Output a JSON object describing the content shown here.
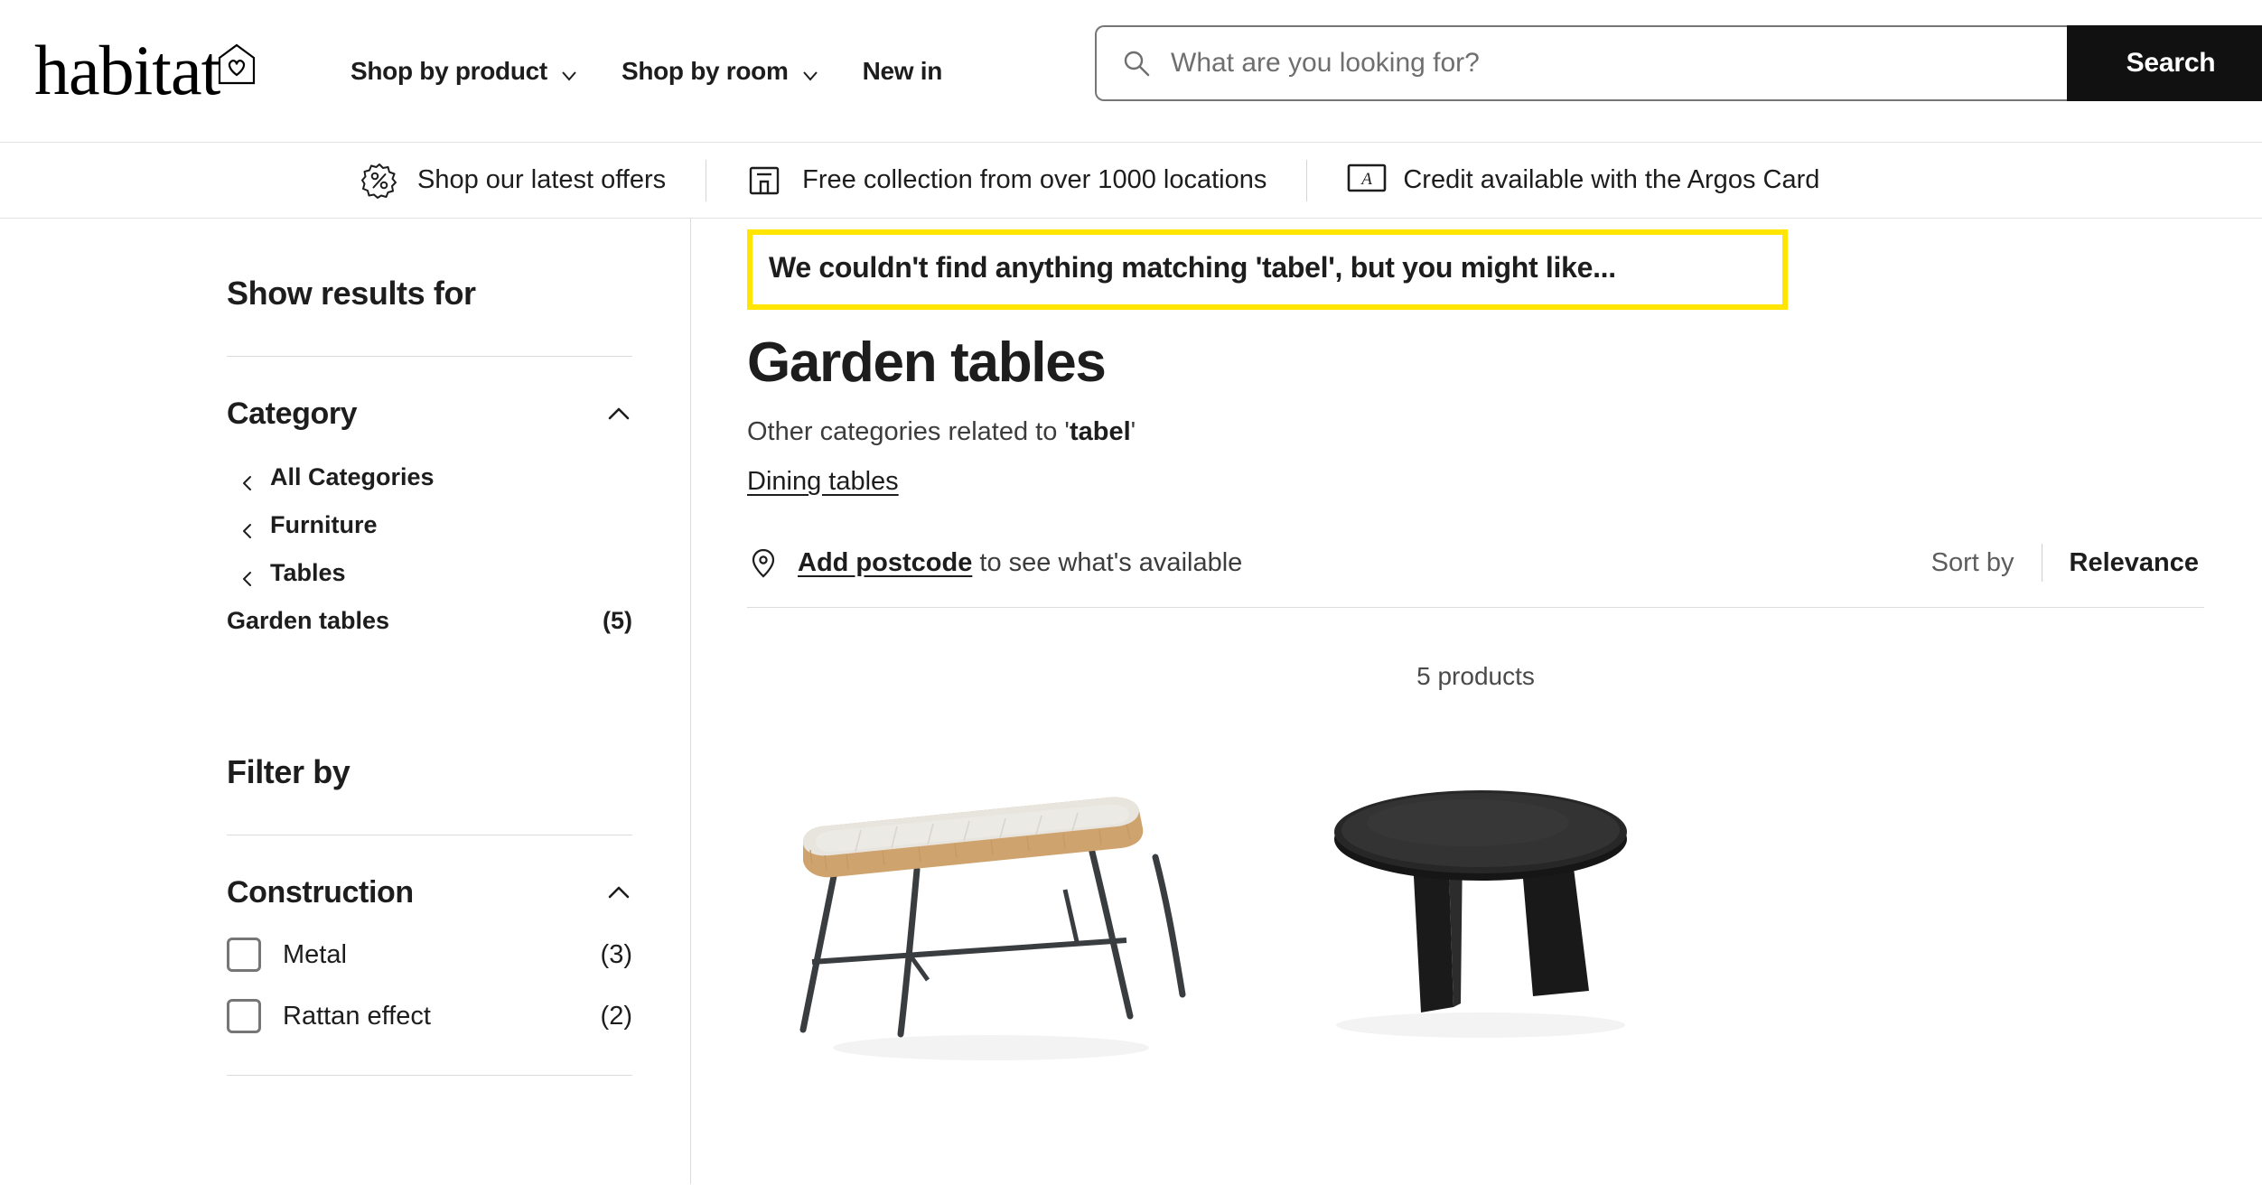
{
  "brand": {
    "name": "habitat",
    "logo_icon": "house-heart-icon"
  },
  "nav": {
    "items": [
      {
        "label": "Shop by product",
        "icon": "chevron-down-icon",
        "has_dropdown": true
      },
      {
        "label": "Shop by room",
        "icon": "chevron-down-icon",
        "has_dropdown": true
      },
      {
        "label": "New in",
        "has_dropdown": false
      }
    ]
  },
  "search": {
    "icon": "search-icon",
    "placeholder": "What are you looking for?",
    "value": "",
    "button_label": "Search"
  },
  "usp": {
    "items": [
      {
        "icon": "percent-badge-icon",
        "label": "Shop our latest offers"
      },
      {
        "icon": "store-icon",
        "label": "Free collection from over 1000 locations"
      },
      {
        "icon": "argos-card-icon",
        "label": "Credit available with the Argos Card"
      }
    ]
  },
  "sidebar": {
    "show_results_heading": "Show results for",
    "category_facet": {
      "title": "Category",
      "toggle_icon": "chevron-up-icon",
      "parents": [
        {
          "label": "All Categories",
          "icon": "chevron-left-icon"
        },
        {
          "label": "Furniture",
          "icon": "chevron-left-icon"
        },
        {
          "label": "Tables",
          "icon": "chevron-left-icon"
        }
      ],
      "current": {
        "label": "Garden tables",
        "count": "(5)"
      }
    },
    "filter_by_heading": "Filter by",
    "construction_facet": {
      "title": "Construction",
      "toggle_icon": "chevron-up-icon",
      "options": [
        {
          "label": "Metal",
          "count": "(3)",
          "checked": false
        },
        {
          "label": "Rattan effect",
          "count": "(2)",
          "checked": false
        }
      ]
    }
  },
  "main": {
    "alert": {
      "text": "We couldn't find anything matching 'tabel', but you might like...",
      "border_color": "#ffe500"
    },
    "page_title": "Garden tables",
    "related_prefix": "Other categories related to '",
    "related_term": "tabel",
    "related_suffix": "'",
    "related_links": [
      "Dining tables"
    ],
    "postcode": {
      "icon": "location-pin-icon",
      "link_label": "Add postcode",
      "suffix": " to see what's available"
    },
    "sort": {
      "label": "Sort by",
      "value": "Relevance"
    },
    "product_count": "5 products",
    "products": [
      {
        "name": "rattan-top-garden-table",
        "image_icon": "rattan-table-image"
      },
      {
        "name": "black-round-garden-table",
        "image_icon": "round-black-table-image"
      }
    ]
  },
  "colors": {
    "accent_yellow": "#ffe500",
    "button_black": "#111111",
    "text": "#1d1d1d"
  }
}
